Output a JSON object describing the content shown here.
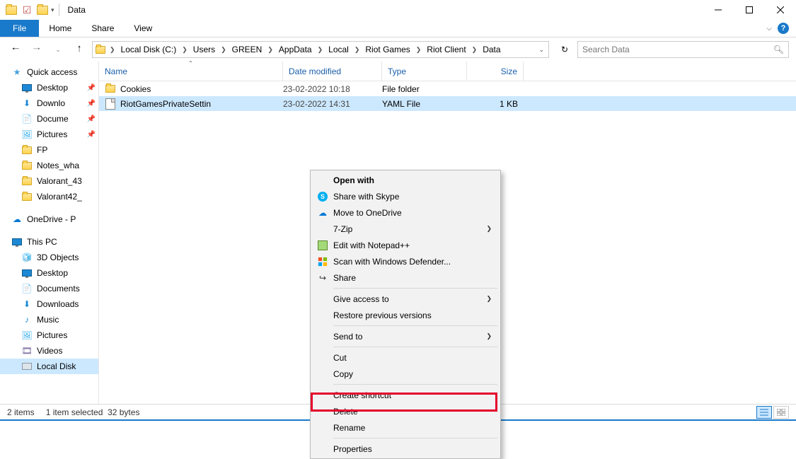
{
  "titlebar": {
    "title": "Data"
  },
  "ribbon": {
    "file": "File",
    "home": "Home",
    "share": "Share",
    "view": "View"
  },
  "breadcrumb": [
    "Local Disk (C:)",
    "Users",
    "GREEN",
    "AppData",
    "Local",
    "Riot Games",
    "Riot Client",
    "Data"
  ],
  "search": {
    "placeholder": "Search Data"
  },
  "columns": {
    "name": "Name",
    "date": "Date modified",
    "type": "Type",
    "size": "Size"
  },
  "rows": [
    {
      "name": "Cookies",
      "date": "23-02-2022 10:18",
      "type": "File folder",
      "size": "",
      "icon": "folder"
    },
    {
      "name": "RiotGamesPrivateSettin",
      "date": "23-02-2022 14:31",
      "type": "YAML File",
      "size": "1 KB",
      "icon": "file"
    }
  ],
  "sidebar": {
    "quick": "Quick access",
    "items1": [
      "Desktop",
      "Downlo",
      "Docume",
      "Pictures",
      "FP",
      "Notes_wha",
      "Valorant_43",
      "Valorant42_"
    ],
    "onedrive": "OneDrive - P",
    "thispc": "This PC",
    "items2": [
      "3D Objects",
      "Desktop",
      "Documents",
      "Downloads",
      "Music",
      "Pictures",
      "Videos",
      "Local Disk"
    ]
  },
  "ctx": {
    "openwith": "Open with",
    "skype": "Share with Skype",
    "onedrive": "Move to OneDrive",
    "sevenzip": "7-Zip",
    "npp": "Edit with Notepad++",
    "defender": "Scan with Windows Defender...",
    "share": "Share",
    "giveaccess": "Give access to",
    "restore": "Restore previous versions",
    "sendto": "Send to",
    "cut": "Cut",
    "copy": "Copy",
    "shortcut": "Create shortcut",
    "delete": "Delete",
    "rename": "Rename",
    "properties": "Properties"
  },
  "status": {
    "count": "2 items",
    "selected": "1 item selected",
    "size": "32 bytes"
  }
}
